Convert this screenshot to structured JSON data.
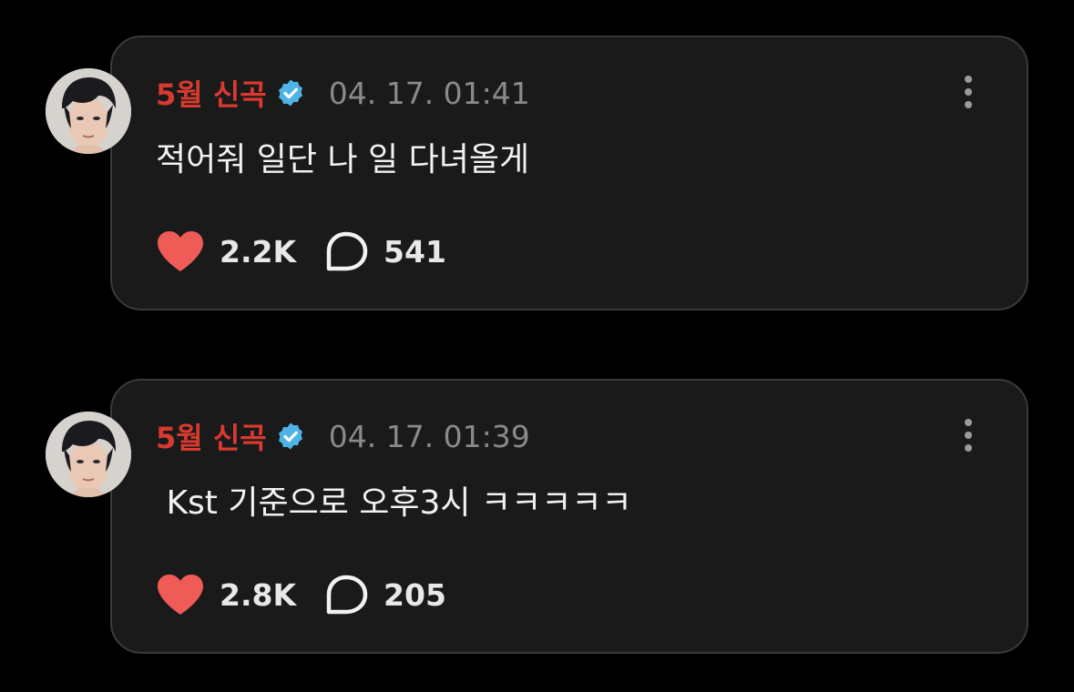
{
  "colors": {
    "background": "#000000",
    "card": "#1a1a1a",
    "card_border": "#3a3a3a",
    "username": "#d93a30",
    "verified_badge": "#4fb3e8",
    "timestamp": "#8a8a8a",
    "heart": "#ef5b57",
    "text": "#f2f2f2"
  },
  "posts": [
    {
      "username": "5월 신곡",
      "verified_icon": "verified-badge-icon",
      "timestamp": "04. 17. 01:41",
      "content": "적어줘 일단 나 일 다녀올게",
      "likes": "2.2K",
      "replies": "541"
    },
    {
      "username": "5월 신곡",
      "verified_icon": "verified-badge-icon",
      "timestamp": "04. 17. 01:39",
      "content": " Kst 기준으로 오후3시 ㅋㅋㅋㅋㅋ",
      "likes": "2.8K",
      "replies": "205"
    }
  ]
}
